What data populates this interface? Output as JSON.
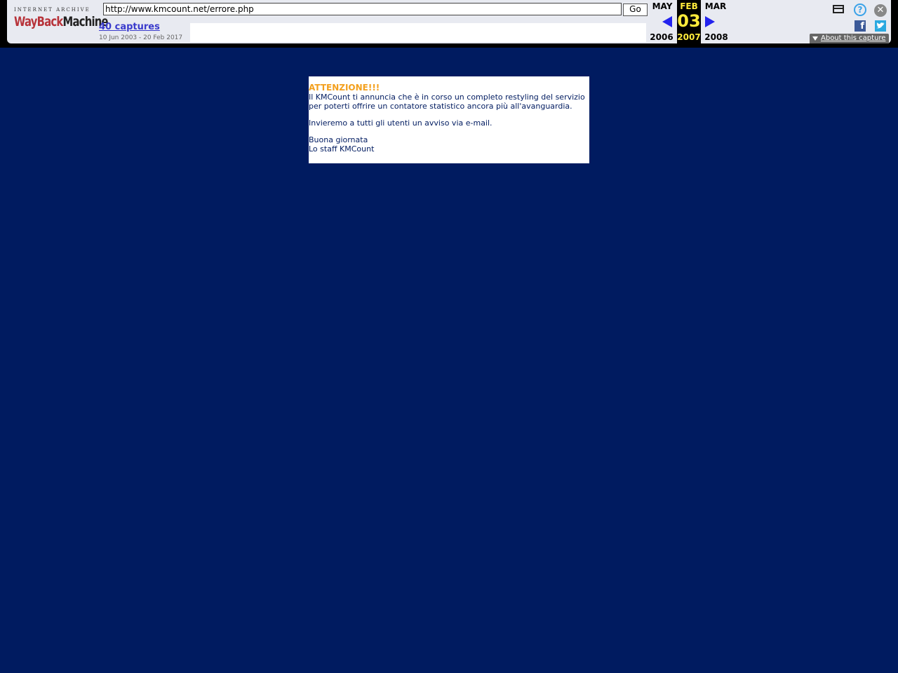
{
  "wayback": {
    "logo_top": "INTERNET ARCHIVE",
    "logo_way": "WayBack",
    "logo_machine": "Machine",
    "url": "http://www.kmcount.net/errore.php",
    "go_label": "Go",
    "captures_label": "40 captures",
    "captures_range": "10 Jun 2003 - 20 Feb 2017",
    "calendar": {
      "prev_month": "MAY",
      "prev_year": "2006",
      "current_month": "FEB",
      "current_day": "03",
      "current_year": "2007",
      "next_month": "MAR",
      "next_year": "2008"
    },
    "about_label": "About this capture",
    "icons": {
      "window": "window-icon",
      "help": "help-icon",
      "close": "close-icon",
      "facebook": "facebook-icon",
      "twitter": "twitter-icon"
    },
    "help_glyph": "?",
    "close_glyph": "✕",
    "facebook_glyph": "f",
    "twitter_glyph": "🐦"
  },
  "notice": {
    "title": "ATTENZIONE!!!",
    "message": "Il KMCount ti annuncia che è in corso un completo restyling del servizio per poterti offrire un contatore statistico ancora più all'avanguardia.",
    "email_note": "Invieremo a tutti gli utenti un avviso via e-mail.",
    "greeting": "Buona giornata",
    "signature": "Lo staff KMCount"
  },
  "colors": {
    "page_background": "#001b60",
    "notice_title": "#f3a01e",
    "notice_text": "#001b60",
    "current_date_highlight": "#ffeb3b",
    "nav_arrows": "#2323ee"
  }
}
